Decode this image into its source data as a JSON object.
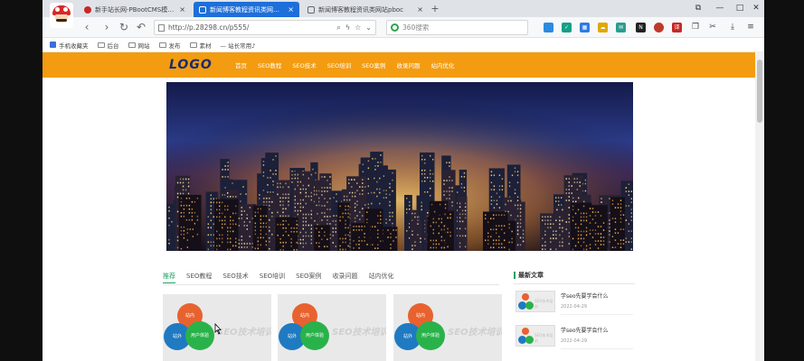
{
  "browser": {
    "tabs": [
      {
        "label": "新手站长网-PBootCMS模板-F",
        "active": false
      },
      {
        "label": "新闻博客教程资讯类网站pbo",
        "active": true
      },
      {
        "label": "新闻博客教程资讯类网站pboc",
        "active": false
      }
    ],
    "new_tab_label": "+",
    "close_glyph": "×",
    "window_controls": {
      "restore": "⧉",
      "minimize": "—",
      "maximize": "□",
      "close": "✕"
    },
    "nav": {
      "back": "‹",
      "forward": "›",
      "reload": "↻",
      "undo": "↶"
    },
    "url": "http://p.28298.cn/p555/",
    "url_actions": {
      "search": "⌕",
      "flash": "ϟ",
      "star": "☆",
      "dropdown": "⌄"
    },
    "search_placeholder": "360搜索",
    "extension_badges": {
      "notes": "N",
      "shield": "✓",
      "grid": "▦",
      "cloud": "☁",
      "mail": "✉",
      "translate": "译",
      "copy": "❐",
      "cut": "✂",
      "download": "⤓",
      "menu": "≡"
    }
  },
  "bookmarks": [
    {
      "label": "手机收藏夹",
      "type": "star"
    },
    {
      "label": "后台",
      "type": "folder"
    },
    {
      "label": "网站",
      "type": "folder"
    },
    {
      "label": "发布",
      "type": "folder"
    },
    {
      "label": "素材",
      "type": "folder"
    },
    {
      "label": "— 站长常用♪",
      "type": "link"
    }
  ],
  "site": {
    "logo": "LOGO",
    "nav": [
      "首页",
      "SEO教程",
      "SEO技术",
      "SEO培训",
      "SEO案例",
      "收录问题",
      "站内优化"
    ],
    "content_tabs": [
      "推荐",
      "SEO教程",
      "SEO技术",
      "SEO培训",
      "SEO案例",
      "收录问题",
      "站内优化"
    ],
    "cards": [
      {
        "circle_top": "站内",
        "circle_left": "站外",
        "circle_right": "用户体验",
        "text": "SEO技术培训"
      },
      {
        "circle_top": "站内",
        "circle_left": "站外",
        "circle_right": "用户体验",
        "text": "SEO技术培训"
      },
      {
        "circle_top": "站内",
        "circle_left": "站外",
        "circle_right": "用户体验",
        "text": "SEO技术培训"
      }
    ],
    "sidebar_title": "最新文章",
    "articles": [
      {
        "title": "学seo先要学会什么",
        "date": "2022-04-29",
        "thumb_text": "SEO技术培训"
      },
      {
        "title": "学seo先要学会什么",
        "date": "2022-04-29",
        "thumb_text": "SEO技术培训"
      }
    ]
  },
  "colors": {
    "header": "#f39c12",
    "active_tab": "#1e6fd9",
    "accent_green": "#1aa260",
    "logo_text": "#1a2c6b"
  }
}
